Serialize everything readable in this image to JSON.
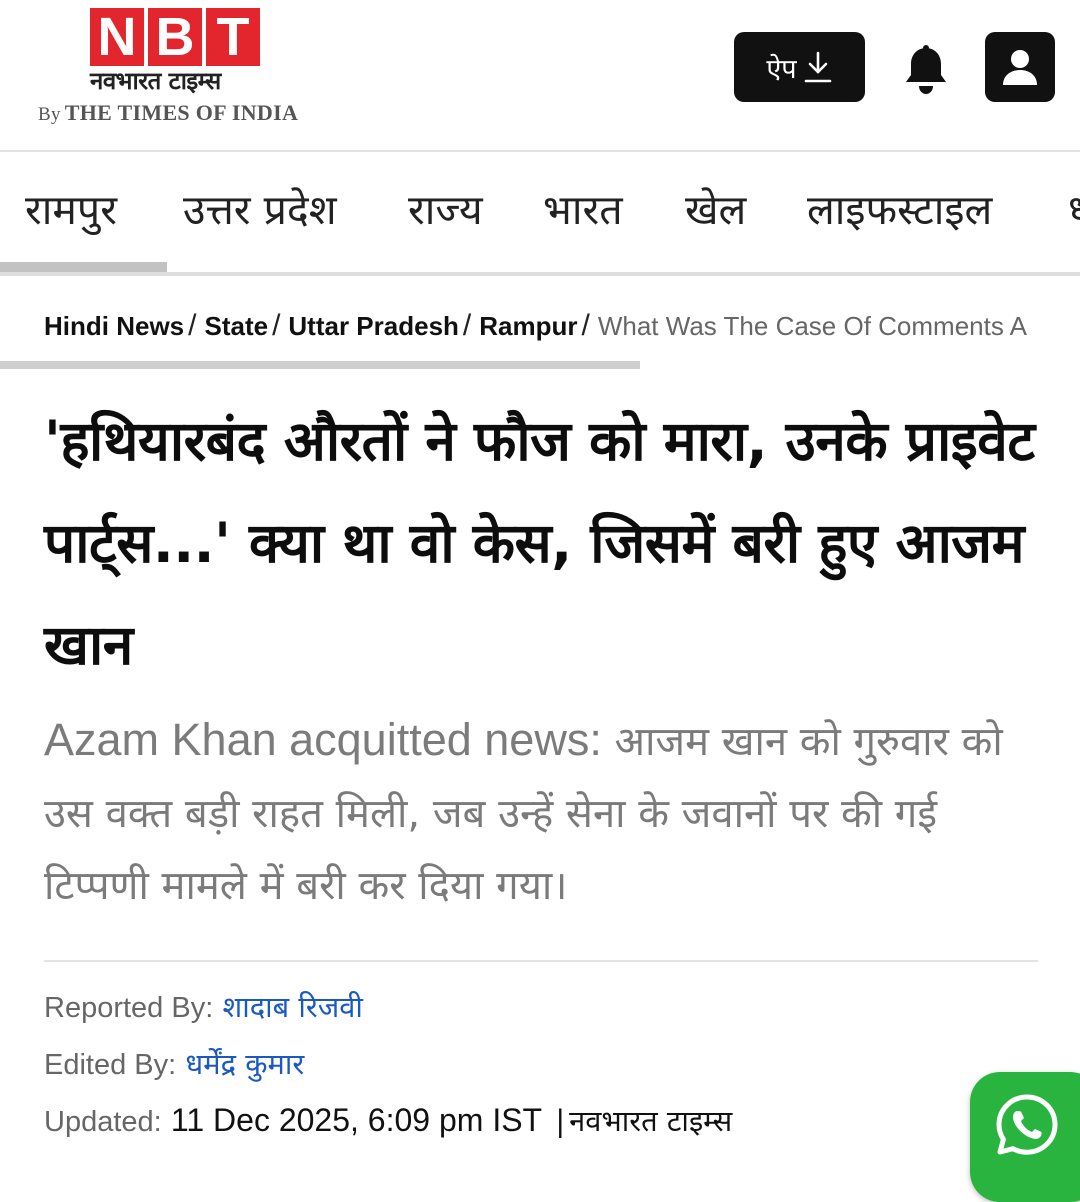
{
  "header": {
    "logo_letters": [
      "N",
      "B",
      "T"
    ],
    "logo_hindi": "नवभारत टाइम्स",
    "logo_by": "By",
    "logo_brand": "THE TIMES OF INDIA",
    "app_button_label": "ऐप",
    "app_button_icon": "download-icon",
    "bell_icon": "bell-icon",
    "user_icon": "user-icon"
  },
  "nav": {
    "items": [
      {
        "label": "रामपुर",
        "active": true
      },
      {
        "label": "उत्तर प्रदेश"
      },
      {
        "label": "राज्य"
      },
      {
        "label": "भारत"
      },
      {
        "label": "खेल"
      },
      {
        "label": "लाइफस्टाइल"
      },
      {
        "label": "ध"
      }
    ]
  },
  "breadcrumb": {
    "items": [
      "Hindi News",
      "State",
      "Uttar Pradesh",
      "Rampur"
    ],
    "separator": "/",
    "current": "What Was The Case Of Comments A"
  },
  "article": {
    "headline": "'हथियारबंद औरतों ने फौज को मारा, उनके प्राइवेट पार्ट्स...' क्या था वो केस, जिसमें बरी हुए आजम खान",
    "summary_lead": "Azam Khan acquitted news:",
    "summary_text": " आजम खान को गुरुवार को उस वक्त बड़ी राहत मिली, जब उन्हें सेना के जवानों पर की गई टिप्पणी मामले में बरी कर दिया गया।",
    "reported_by_label": "Reported By:",
    "reported_by": "शादाब रिजवी",
    "edited_by_label": "Edited By:",
    "edited_by": "धर्मेंद्र कुमार",
    "updated_label": "Updated:",
    "updated_value": "11 Dec 2025, 6:09 pm IST",
    "updated_separator": "|",
    "publisher": "नवभारत टाइम्स"
  },
  "floating": {
    "whatsapp_icon": "whatsapp-icon"
  },
  "colors": {
    "brand_red": "#e3262d",
    "link_blue": "#1a59c4",
    "whatsapp_green": "#28b43e",
    "button_black": "#111111"
  }
}
